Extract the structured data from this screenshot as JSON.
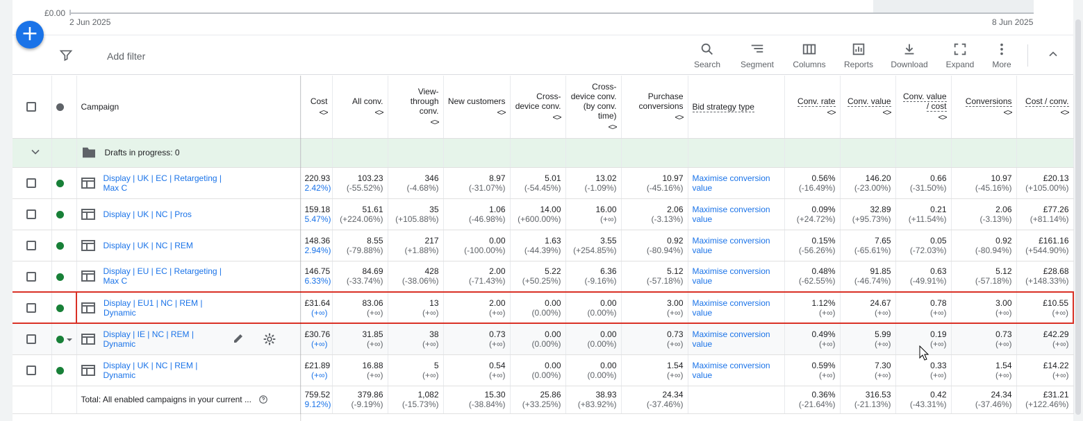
{
  "chart": {
    "y_label": "£0.00",
    "x_start": "2 Jun 2025",
    "x_end": "8 Jun 2025"
  },
  "toolbar": {
    "add_filter": "Add filter",
    "tools": [
      {
        "label": "Search",
        "icon": "search-icon"
      },
      {
        "label": "Segment",
        "icon": "segment-icon"
      },
      {
        "label": "Columns",
        "icon": "columns-icon"
      },
      {
        "label": "Reports",
        "icon": "reports-icon"
      },
      {
        "label": "Download",
        "icon": "download-icon"
      },
      {
        "label": "Expand",
        "icon": "expand-icon"
      },
      {
        "label": "More",
        "icon": "more-icon"
      }
    ]
  },
  "headers": {
    "campaign": "Campaign",
    "cost": "Cost",
    "all_conv": "All conv.",
    "view_through": "View-through conv.",
    "new_customers": "New customers",
    "cross_device": "Cross-device conv.",
    "cross_device_time": "Cross-device conv. (by conv. time)",
    "purchase": "Purchase conversions",
    "bid_strategy": "Bid strategy type",
    "conv_rate": "Conv. rate",
    "conv_value": "Conv. value",
    "conv_value_cost": "Conv. value / cost",
    "conversions": "Conversions",
    "cost_conv": "Cost / conv."
  },
  "drafts": {
    "label": "Drafts in progress: 0"
  },
  "rows": [
    {
      "name": "Display | UK | EC | Retargeting | Max C",
      "cost": "220.93",
      "cost_d": "2.42%)",
      "all_conv": "103.23",
      "all_conv_d": "(-55.52%)",
      "vt": "346",
      "vt_d": "(-4.68%)",
      "nc": "8.97",
      "nc_d": "(-31.07%)",
      "cd": "5.01",
      "cd_d": "(-54.45%)",
      "cdt": "13.02",
      "cdt_d": "(-1.09%)",
      "pc": "10.97",
      "pc_d": "(-45.16%)",
      "bid": "Maximise conversion value",
      "cr": "0.56%",
      "cr_d": "(-16.49%)",
      "cv": "146.20",
      "cv_d": "(-23.00%)",
      "cvc": "0.66",
      "cvc_d": "(-31.50%)",
      "conv": "10.97",
      "conv_d": "(-45.16%)",
      "cpc": "£20.13",
      "cpc_d": "(+105.00%)"
    },
    {
      "name": "Display | UK | NC | Pros",
      "cost": "159.18",
      "cost_d": "5.47%)",
      "all_conv": "51.61",
      "all_conv_d": "(+224.06%)",
      "vt": "35",
      "vt_d": "(+105.88%)",
      "nc": "1.06",
      "nc_d": "(-46.98%)",
      "cd": "14.00",
      "cd_d": "(+600.00%)",
      "cdt": "16.00",
      "cdt_d": "(+∞)",
      "pc": "2.06",
      "pc_d": "(-3.13%)",
      "bid": "Maximise conversion value",
      "cr": "0.09%",
      "cr_d": "(+24.72%)",
      "cv": "32.89",
      "cv_d": "(+95.73%)",
      "cvc": "0.21",
      "cvc_d": "(+11.54%)",
      "conv": "2.06",
      "conv_d": "(-3.13%)",
      "cpc": "£77.26",
      "cpc_d": "(+81.14%)"
    },
    {
      "name": "Display | UK | NC | REM",
      "cost": "148.36",
      "cost_d": "2.94%)",
      "all_conv": "8.55",
      "all_conv_d": "(-79.88%)",
      "vt": "217",
      "vt_d": "(+1.88%)",
      "nc": "0.00",
      "nc_d": "(-100.00%)",
      "cd": "1.63",
      "cd_d": "(-44.39%)",
      "cdt": "3.55",
      "cdt_d": "(+254.85%)",
      "pc": "0.92",
      "pc_d": "(-80.94%)",
      "bid": "Maximise conversion value",
      "cr": "0.15%",
      "cr_d": "(-56.26%)",
      "cv": "7.65",
      "cv_d": "(-65.61%)",
      "cvc": "0.05",
      "cvc_d": "(-72.03%)",
      "conv": "0.92",
      "conv_d": "(-80.94%)",
      "cpc": "£161.16",
      "cpc_d": "(+544.90%)"
    },
    {
      "name": "Display | EU | EC | Retargeting | Max C",
      "cost": "146.75",
      "cost_d": "6.33%)",
      "all_conv": "84.69",
      "all_conv_d": "(-33.74%)",
      "vt": "428",
      "vt_d": "(-38.06%)",
      "nc": "2.00",
      "nc_d": "(-71.43%)",
      "cd": "5.22",
      "cd_d": "(+50.25%)",
      "cdt": "6.36",
      "cdt_d": "(-9.16%)",
      "pc": "5.12",
      "pc_d": "(-57.18%)",
      "bid": "Maximise conversion value",
      "cr": "0.48%",
      "cr_d": "(-62.55%)",
      "cv": "91.85",
      "cv_d": "(-46.74%)",
      "cvc": "0.63",
      "cvc_d": "(-49.91%)",
      "conv": "5.12",
      "conv_d": "(-57.18%)",
      "cpc": "£28.68",
      "cpc_d": "(+148.33%)"
    },
    {
      "name": "Display | EU1 | NC | REM | Dynamic",
      "cost": "£31.64",
      "cost_d": "(+∞)",
      "all_conv": "83.06",
      "all_conv_d": "(+∞)",
      "vt": "13",
      "vt_d": "(+∞)",
      "nc": "2.00",
      "nc_d": "(+∞)",
      "cd": "0.00",
      "cd_d": "(0.00%)",
      "cdt": "0.00",
      "cdt_d": "(0.00%)",
      "pc": "3.00",
      "pc_d": "(+∞)",
      "bid": "Maximise conversion value",
      "cr": "1.12%",
      "cr_d": "(+∞)",
      "cv": "24.67",
      "cv_d": "(+∞)",
      "cvc": "0.78",
      "cvc_d": "(+∞)",
      "conv": "3.00",
      "conv_d": "(+∞)",
      "cpc": "£10.55",
      "cpc_d": "(+∞)"
    },
    {
      "name": "Display | IE | NC | REM | Dynamic",
      "cost": "£30.76",
      "cost_d": "(+∞)",
      "all_conv": "31.85",
      "all_conv_d": "(+∞)",
      "vt": "38",
      "vt_d": "(+∞)",
      "nc": "0.73",
      "nc_d": "(+∞)",
      "cd": "0.00",
      "cd_d": "(0.00%)",
      "cdt": "0.00",
      "cdt_d": "(0.00%)",
      "pc": "0.73",
      "pc_d": "(+∞)",
      "bid": "Maximise conversion value",
      "cr": "0.49%",
      "cr_d": "(+∞)",
      "cv": "5.99",
      "cv_d": "(+∞)",
      "cvc": "0.19",
      "cvc_d": "(+∞)",
      "conv": "0.73",
      "conv_d": "(+∞)",
      "cpc": "£42.29",
      "cpc_d": "(+∞)"
    },
    {
      "name": "Display | UK | NC | REM | Dynamic",
      "cost": "£21.89",
      "cost_d": "(+∞)",
      "all_conv": "16.88",
      "all_conv_d": "(+∞)",
      "vt": "5",
      "vt_d": "(+∞)",
      "nc": "0.54",
      "nc_d": "(+∞)",
      "cd": "0.00",
      "cd_d": "(0.00%)",
      "cdt": "0.00",
      "cdt_d": "(0.00%)",
      "pc": "1.54",
      "pc_d": "(+∞)",
      "bid": "Maximise conversion value",
      "cr": "0.59%",
      "cr_d": "(+∞)",
      "cv": "7.30",
      "cv_d": "(+∞)",
      "cvc": "0.33",
      "cvc_d": "(+∞)",
      "conv": "1.54",
      "conv_d": "(+∞)",
      "cpc": "£14.22",
      "cpc_d": "(+∞)"
    }
  ],
  "total": {
    "label": "Total: All enabled campaigns in your current ...",
    "cost": "759.52",
    "cost_d": "9.12%)",
    "all_conv": "379.86",
    "all_conv_d": "(-9.19%)",
    "vt": "1,082",
    "vt_d": "(-15.73%)",
    "nc": "15.30",
    "nc_d": "(-38.84%)",
    "cd": "25.86",
    "cd_d": "(+33.25%)",
    "cdt": "38.93",
    "cdt_d": "(+83.92%)",
    "pc": "24.34",
    "pc_d": "(-37.46%)",
    "bid": "",
    "cr": "0.36%",
    "cr_d": "(-21.64%)",
    "cv": "316.53",
    "cv_d": "(-21.13%)",
    "cvc": "0.42",
    "cvc_d": "(-43.31%)",
    "conv": "24.34",
    "conv_d": "(-37.46%)",
    "cpc": "£31.21",
    "cpc_d": "(+122.46%)"
  },
  "colors": {
    "accent": "#1a73e8",
    "enabled": "#188038",
    "highlight": "#d93025",
    "drafts_bg": "#e6f4ea"
  }
}
